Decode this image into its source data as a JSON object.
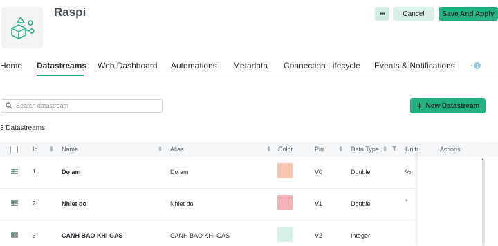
{
  "header": {
    "title": "Raspi",
    "more_label": "•••",
    "cancel_label": "Cancel",
    "save_label": "Save And Apply"
  },
  "tabs": [
    {
      "label": "Home"
    },
    {
      "label": "Datastreams"
    },
    {
      "label": "Web Dashboard"
    },
    {
      "label": "Automations"
    },
    {
      "label": "Metadata"
    },
    {
      "label": "Connection Lifecycle"
    },
    {
      "label": "Events & Notifications"
    }
  ],
  "search": {
    "placeholder": "Search datastream"
  },
  "new_button": {
    "icon": "plus-icon",
    "label": "New Datastream"
  },
  "count_label": "3 Datastreams",
  "table": {
    "headers": {
      "id": "Id",
      "name": "Name",
      "alias": "Alias",
      "color": "Color",
      "pin": "Pin",
      "data_type": "Data Type",
      "units": "Units",
      "actions": "Actions"
    },
    "rows": [
      {
        "id": "1",
        "name": "Do am",
        "alias": "Do am",
        "color": "#f9c6b1",
        "pin": "V0",
        "data_type": "Double",
        "units": "%"
      },
      {
        "id": "2",
        "name": "Nhiet do",
        "alias": "Nhiet do",
        "color": "#f5b3b8",
        "pin": "V1",
        "data_type": "Double",
        "units": "°"
      },
      {
        "id": "3",
        "name": "CANH BAO KHI GAS",
        "alias": "CANH BAO KHI GAS",
        "color": "#d6f2e8",
        "pin": "V2",
        "data_type": "Integer",
        "units": ""
      }
    ]
  },
  "colors": {
    "accent": "#23b17f",
    "accent_light": "#d8eee6"
  }
}
